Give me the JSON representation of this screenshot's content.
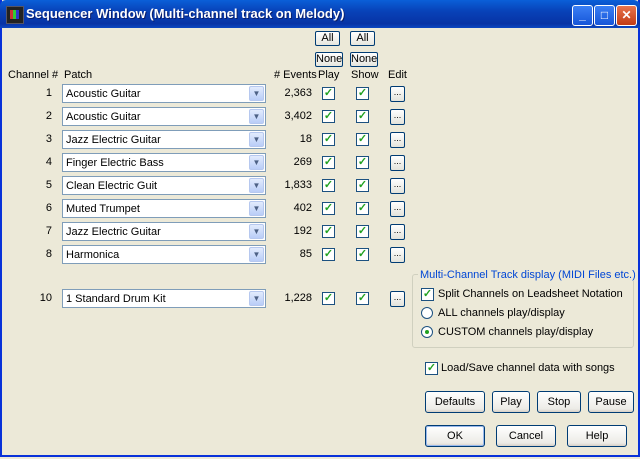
{
  "window": {
    "title": "Sequencer Window  (Multi-channel track on Melody)",
    "controls": {
      "minimize": "_",
      "maximize": "□",
      "close": "✕"
    }
  },
  "header": {
    "channel": "Channel #",
    "patch": "Patch",
    "events": "# Events",
    "play": "Play",
    "show": "Show",
    "edit": "Edit",
    "play_all": "All",
    "play_none": "None",
    "show_all": "All",
    "show_none": "None"
  },
  "rows": [
    {
      "channel": "1",
      "patch": "Acoustic Guitar",
      "events": "2,363",
      "play": true,
      "show": true,
      "edit": "..."
    },
    {
      "channel": "2",
      "patch": "Acoustic Guitar",
      "events": "3,402",
      "play": true,
      "show": true,
      "edit": "..."
    },
    {
      "channel": "3",
      "patch": "Jazz Electric Guitar",
      "events": "18",
      "play": true,
      "show": true,
      "edit": "..."
    },
    {
      "channel": "4",
      "patch": "Finger Electric Bass",
      "events": "269",
      "play": true,
      "show": true,
      "edit": "..."
    },
    {
      "channel": "5",
      "patch": "Clean Electric Guit",
      "events": "1,833",
      "play": true,
      "show": true,
      "edit": "..."
    },
    {
      "channel": "6",
      "patch": "Muted Trumpet",
      "events": "402",
      "play": true,
      "show": true,
      "edit": "..."
    },
    {
      "channel": "7",
      "patch": "Jazz Electric Guitar",
      "events": "192",
      "play": true,
      "show": true,
      "edit": "..."
    },
    {
      "channel": "8",
      "patch": "Harmonica",
      "events": "85",
      "play": true,
      "show": true,
      "edit": "..."
    },
    {
      "channel": "10",
      "patch": "1 Standard Drum Kit",
      "events": "1,228",
      "play": true,
      "show": true,
      "edit": "..."
    }
  ],
  "group": {
    "title": "Multi-Channel Track display (MIDI Files etc.)",
    "split_label": "Split Channels on Leadsheet Notation",
    "split_checked": true,
    "all_label": "ALL channels play/display",
    "custom_label": "CUSTOM channels play/display",
    "selected": "custom"
  },
  "loadsave": {
    "label": "Load/Save channel data with songs",
    "checked": true
  },
  "buttons": {
    "defaults": "Defaults",
    "play": "Play",
    "stop": "Stop",
    "pause": "Pause",
    "ok": "OK",
    "cancel": "Cancel",
    "help": "Help"
  },
  "colors": {
    "title_bar": "#0842b8",
    "group_title": "#0046d5",
    "check": "#21a121"
  }
}
